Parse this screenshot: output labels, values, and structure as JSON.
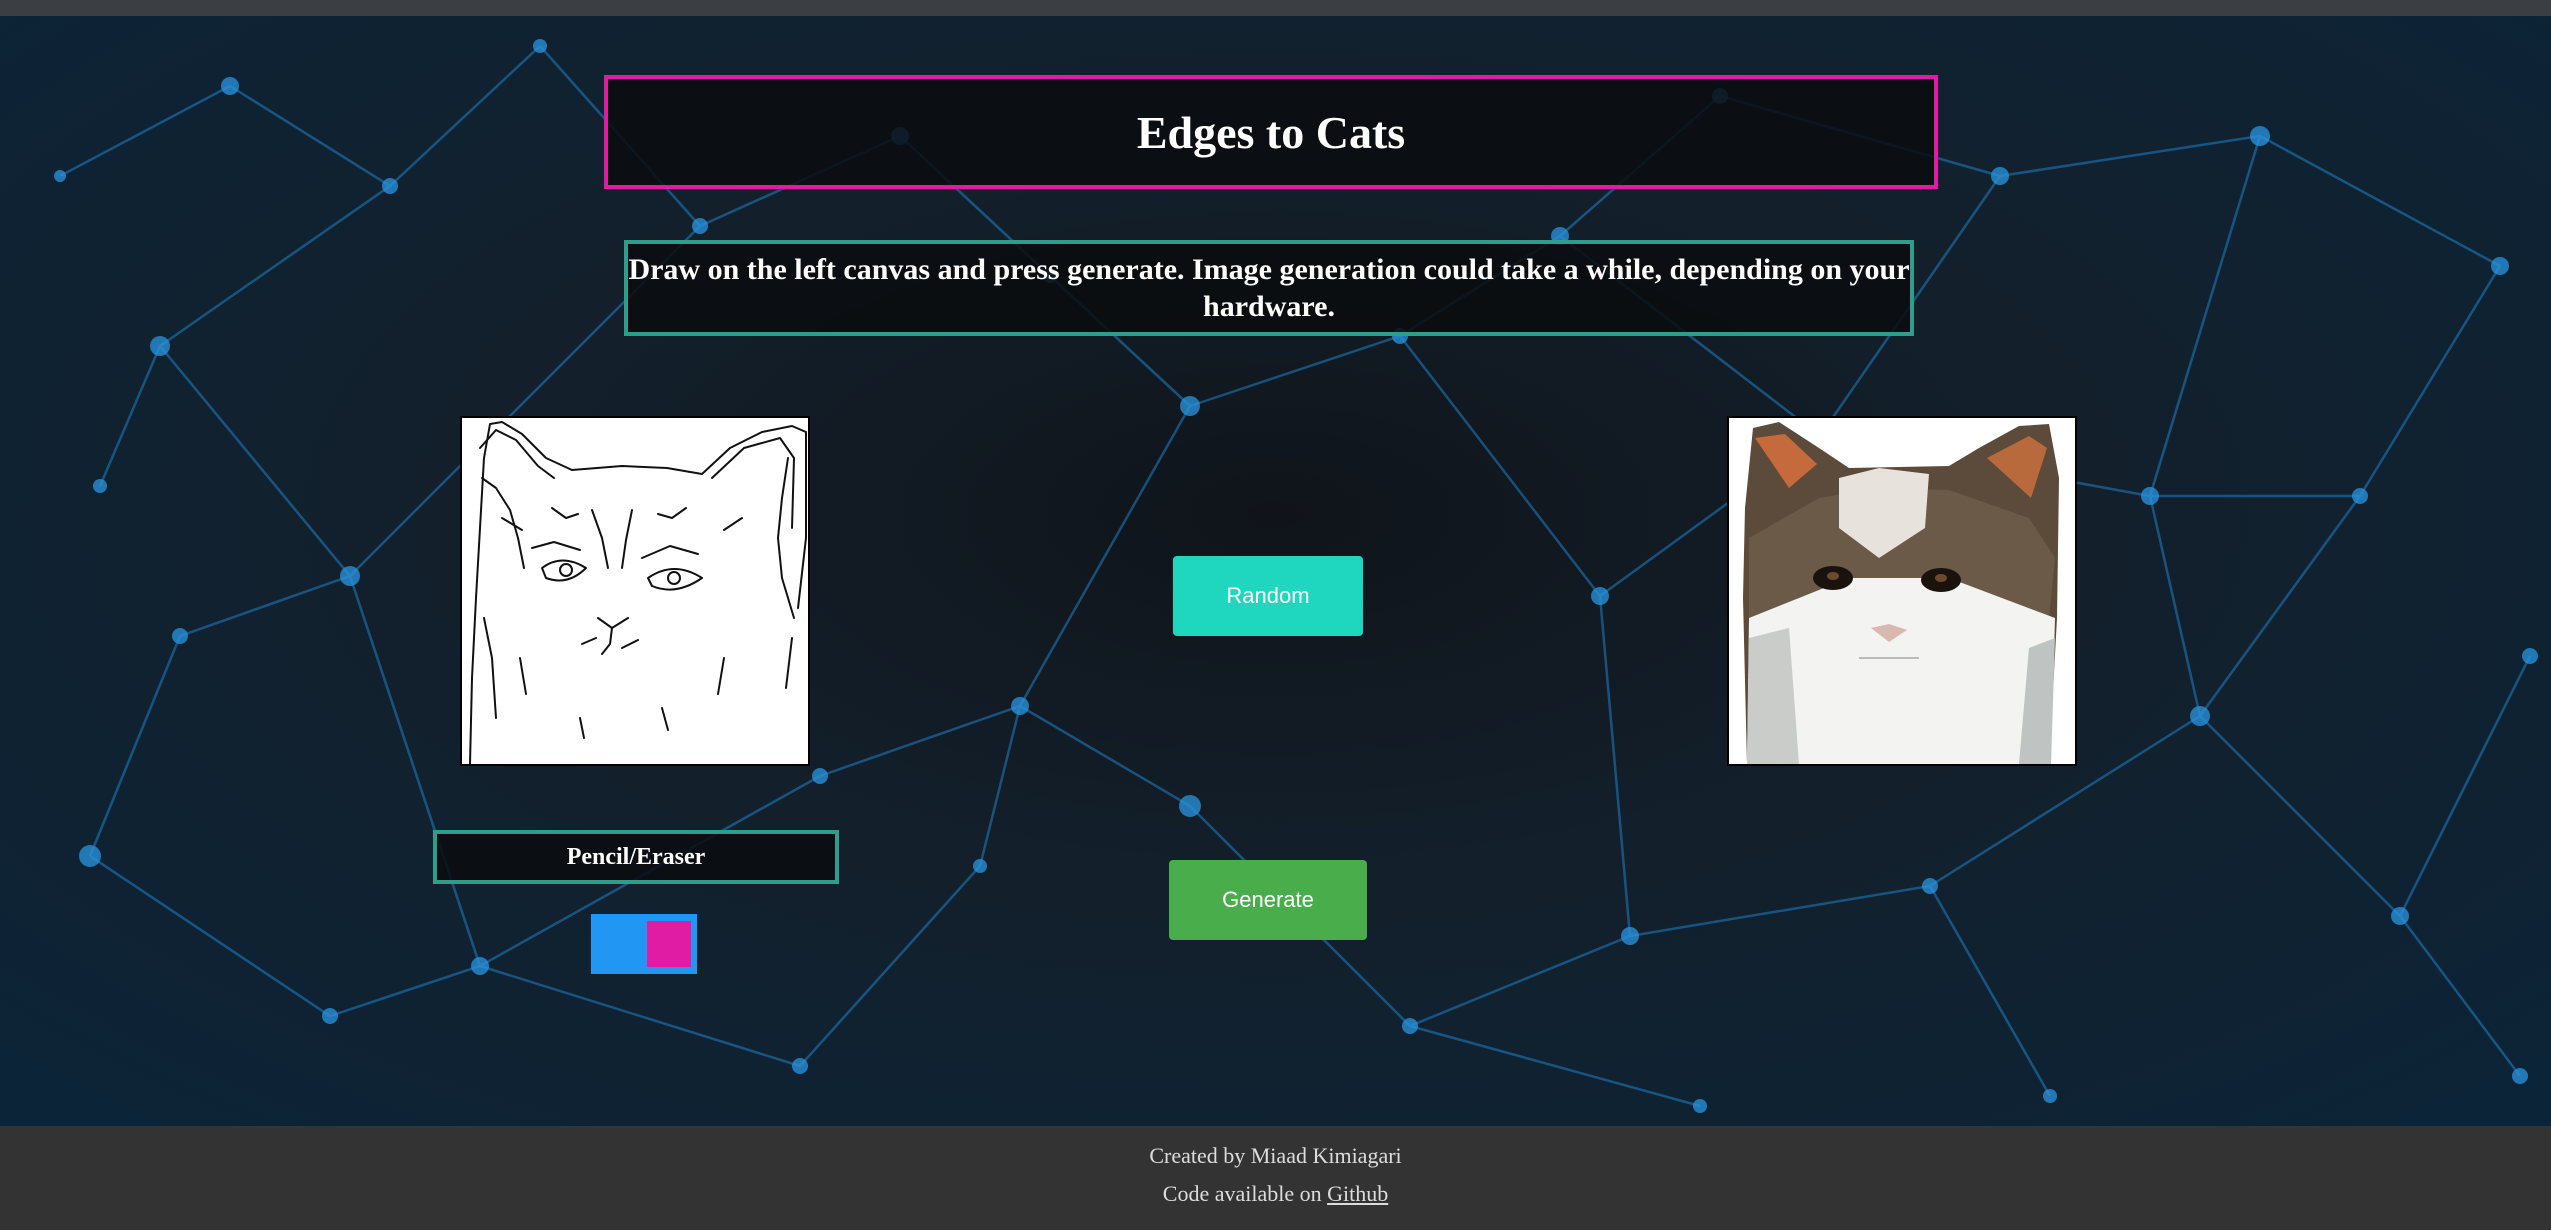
{
  "header": {
    "title": "Edges to Cats",
    "instructions": "Draw on the left canvas and press generate. Image generation could take a while, depending on your hardware."
  },
  "controls": {
    "random_label": "Random",
    "generate_label": "Generate",
    "tool_label": "Pencil/Eraser"
  },
  "footer": {
    "credit": "Created by Miaad Kimiagari",
    "code_prefix": "Code available on ",
    "code_link": "Github"
  },
  "colors": {
    "title_border": "#e01ca4",
    "box_border": "#2e9e8b",
    "random_button": "#1fd6bf",
    "generate_button": "#49ad4c",
    "toggle_track": "#2196f3",
    "toggle_knob": "#e01ca4",
    "footer_bg": "#333333"
  }
}
